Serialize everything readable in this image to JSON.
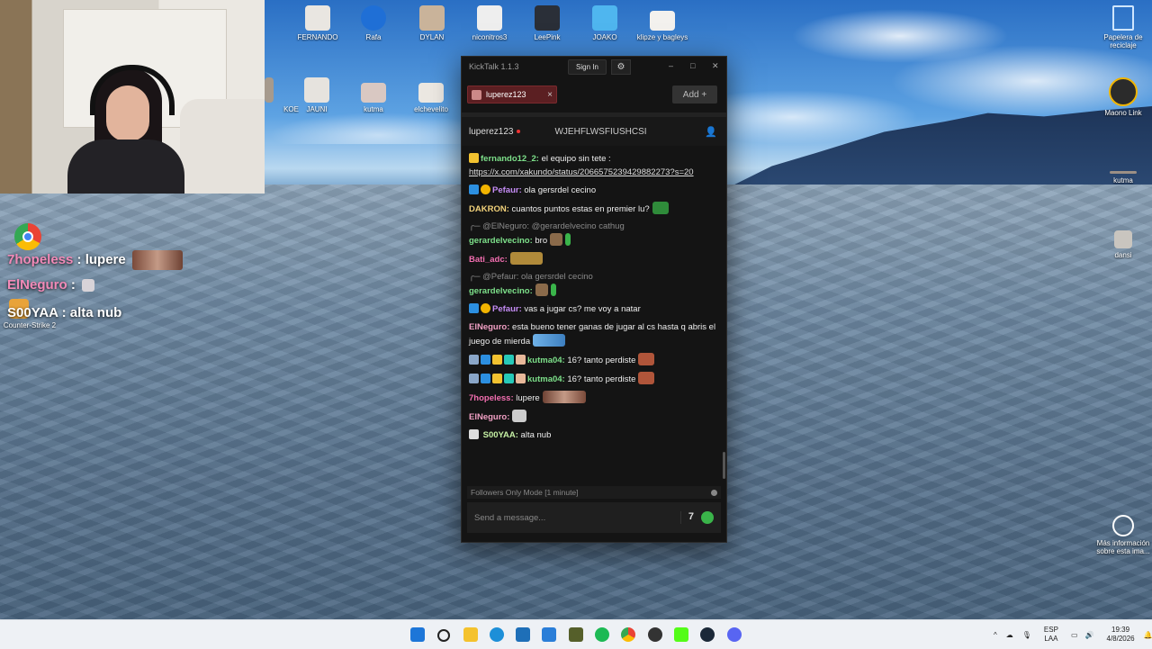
{
  "desktop_icons": [
    {
      "label": "FERNANDO",
      "icon": "cat-photo-icon"
    },
    {
      "label": "Rafa",
      "icon": "rocket-league-icon"
    },
    {
      "label": "DYLAN",
      "icon": "photo-icon"
    },
    {
      "label": "niconitros3",
      "icon": "game-icon"
    },
    {
      "label": "LeePink",
      "icon": "counter-strike-icon"
    },
    {
      "label": "JOAKO",
      "icon": "stumble-guys-icon"
    },
    {
      "label": "klipze y bagleys",
      "icon": "photo-icon"
    },
    {
      "label": "Papelera de reciclaje",
      "icon": "recycle-bin-icon"
    },
    {
      "label": "KOE",
      "icon": "photo-icon"
    },
    {
      "label": "JAUNI",
      "icon": "cat-photo-icon"
    },
    {
      "label": "kutma",
      "icon": "photo-icon"
    },
    {
      "label": "elchevelito",
      "icon": "photo-icon"
    },
    {
      "label": "Maono Link",
      "icon": "maono-link-icon"
    },
    {
      "label": "kutma",
      "icon": "photo-icon"
    },
    {
      "label": "dansi",
      "icon": "photo-icon"
    },
    {
      "label": "Counter-Strike 2",
      "icon": "counter-strike-icon"
    },
    {
      "label": "Más información sobre esta ima...",
      "icon": "info-camera-icon"
    }
  ],
  "overlay_chat": [
    {
      "user": "7hopeless",
      "sep": " : ",
      "text": "lupere",
      "color": "#f28ab8"
    },
    {
      "user": "ElNeguro",
      "sep": " : ",
      "text": "",
      "color": "#f28ab8"
    },
    {
      "user": "S00YAA",
      "sep": " : ",
      "text": "alta nub",
      "color": "#ffffff"
    }
  ],
  "kicktalk": {
    "app_title": "KickTalk 1.1.3",
    "sign_in": "Sign In",
    "tab_name": "luperez123",
    "add_label": "Add",
    "add_symbol": "+",
    "channel_name": "luperez123",
    "stream_title": "WJEHFLWSFIUSHCSI",
    "messages": [
      {
        "user": "fernando12_2:",
        "color": "#7de08a",
        "text": " el equipo sin tete :",
        "link": "https://x.com/xakundo/status/2066575239429882273?s=20"
      },
      {
        "user": "Pefaur:",
        "color": "#c58cf5",
        "text": " ola gersrdel cecino"
      },
      {
        "user": "DAKRON:",
        "color": "#f2d27a",
        "text": " cuantos puntos estas en premier lu?"
      },
      {
        "reply_to": "@ElNeguro:",
        "reply_text": "@gerardelvecino cathug"
      },
      {
        "user": "gerardelvecino:",
        "color": "#7de08a",
        "text": " bro"
      },
      {
        "user": "Bati_adc:",
        "color": "#f26eb0",
        "text": ""
      },
      {
        "reply_to": "@Pefaur:",
        "reply_text": "ola gersrdel cecino"
      },
      {
        "user": "gerardelvecino:",
        "color": "#7de08a",
        "text": ""
      },
      {
        "user": "Pefaur:",
        "color": "#c58cf5",
        "text": " vas a jugar cs? me voy a natar"
      },
      {
        "user": "ElNeguro:",
        "color": "#f2a0c4",
        "text": " esta bueno tener ganas de jugar al cs hasta q abris el juego de mierda"
      },
      {
        "user": "kutma04:",
        "color": "#7de08a",
        "text": " 16? tanto perdiste"
      },
      {
        "user": "kutma04:",
        "color": "#7de08a",
        "text": " 16? tanto perdiste"
      },
      {
        "user": "7hopeless:",
        "color": "#f26eb0",
        "text": " lupere"
      },
      {
        "user": "ElNeguro:",
        "color": "#f2a0c4",
        "text": ""
      },
      {
        "user": "S00YAA:",
        "color": "#c5f0a4",
        "text": " alta nub"
      }
    ],
    "followers_mode": "Followers Only Mode [1 minute]",
    "input_placeholder": "Send a message..."
  },
  "tray": {
    "lang_top": "ESP",
    "lang_bottom": "LAA",
    "time": "19:39",
    "date": "4/8/2026"
  },
  "colors": {
    "accent_tab": "#5b1f22",
    "live_dot": "#e33333",
    "taskbar": "#eef1f5"
  }
}
